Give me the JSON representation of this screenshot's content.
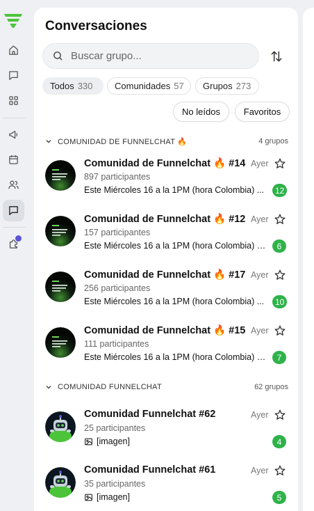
{
  "header": {
    "title": "Conversaciones"
  },
  "search": {
    "placeholder": "Buscar grupo..."
  },
  "filters": [
    {
      "label": "Todos",
      "count": "330"
    },
    {
      "label": "Comunidades",
      "count": "57"
    },
    {
      "label": "Grupos",
      "count": "273"
    }
  ],
  "quick_filters": {
    "unread": "No leídos",
    "favorites": "Favoritos"
  },
  "sections": [
    {
      "title": "COMUNIDAD DE FUNNELCHAT 🔥",
      "count": "4 grupos",
      "rows": [
        {
          "name": "Comunidad de Funnelchat 🔥 #14",
          "participants": "897 participantes",
          "message": "Este Miércoles 16 a la 1PM (hora Colombia) ...",
          "time": "Ayer",
          "unread": "12"
        },
        {
          "name": "Comunidad de Funnelchat 🔥 #12",
          "participants": "157 participantes",
          "message": "Este Miércoles 16 a la 1PM (hora Colombia) t...",
          "time": "Ayer",
          "unread": "6"
        },
        {
          "name": "Comunidad de Funnelchat 🔥 #17",
          "participants": "256 participantes",
          "message": "Este Miércoles 16 a la 1PM (hora Colombia) ...",
          "time": "Ayer",
          "unread": "10"
        },
        {
          "name": "Comunidad de Funnelchat 🔥 #15",
          "participants": "111 participantes",
          "message": "Este Miércoles 16 a la 1PM (hora Colombia) t...",
          "time": "Ayer",
          "unread": "7"
        }
      ]
    },
    {
      "title": "COMUNIDAD FUNNELCHAT",
      "count": "62 grupos",
      "rows": [
        {
          "name": "Comunidad Funnelchat #62",
          "participants": "25 participantes",
          "message": "[imagen]",
          "time": "Ayer",
          "unread": "4"
        },
        {
          "name": "Comunidad Funnelchat #61",
          "participants": "35 participantes",
          "message": "[imagen]",
          "time": "Ayer",
          "unread": "5"
        }
      ]
    }
  ],
  "colors": {
    "accent": "#2fb24a",
    "brand": "#4cc43a",
    "notification": "#5b54d6"
  },
  "icons": [
    "funnel-logo-icon",
    "home-icon",
    "chat-icon",
    "apps-icon",
    "megaphone-icon",
    "calendar-icon",
    "users-icon",
    "chat-active-icon",
    "puzzle-icon",
    "search-icon",
    "sort-icon",
    "chevron-down-icon",
    "star-icon",
    "image-icon"
  ]
}
